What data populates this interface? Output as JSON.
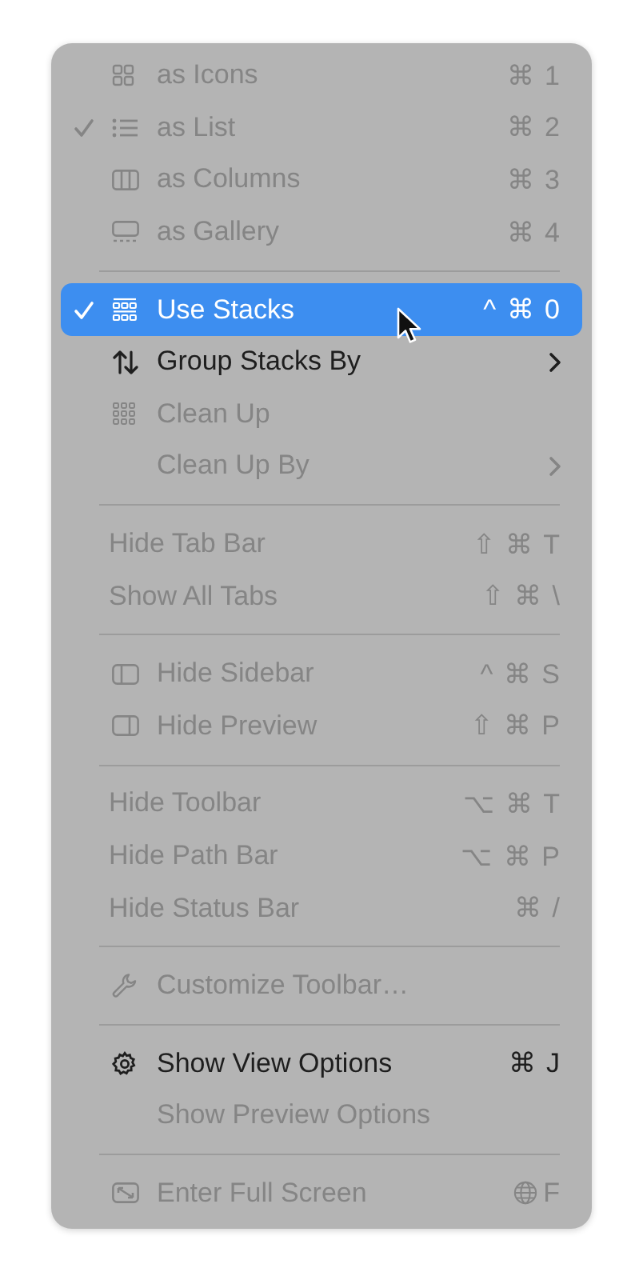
{
  "sections": [
    {
      "items": [
        {
          "label": "as Icons",
          "shortcut": "⌘ 1",
          "kind": "icons",
          "checked": false,
          "disabled": true,
          "selected": false,
          "submenu": false
        },
        {
          "label": "as List",
          "shortcut": "⌘ 2",
          "kind": "list",
          "checked": true,
          "disabled": true,
          "selected": false,
          "submenu": false
        },
        {
          "label": "as Columns",
          "shortcut": "⌘ 3",
          "kind": "columns",
          "checked": false,
          "disabled": true,
          "selected": false,
          "submenu": false
        },
        {
          "label": "as Gallery",
          "shortcut": "⌘ 4",
          "kind": "gallery",
          "checked": false,
          "disabled": true,
          "selected": false,
          "submenu": false
        }
      ]
    },
    {
      "items": [
        {
          "label": "Use Stacks",
          "shortcut": "^ ⌘ 0",
          "kind": "stacks",
          "checked": true,
          "disabled": false,
          "selected": true,
          "submenu": false
        },
        {
          "label": "Group Stacks By",
          "kind": "sort",
          "checked": false,
          "disabled": false,
          "selected": false,
          "submenu": true
        },
        {
          "label": "Clean Up",
          "kind": "cleanup",
          "checked": false,
          "disabled": true,
          "selected": false,
          "submenu": false
        },
        {
          "label": "Clean Up By",
          "kind": "plain",
          "checked": false,
          "disabled": true,
          "selected": false,
          "submenu": true
        }
      ]
    },
    {
      "items": [
        {
          "label": "Hide Tab Bar",
          "shortcut": "⇧ ⌘ T",
          "kind": "noicon",
          "checked": false,
          "disabled": true,
          "selected": false,
          "submenu": false
        },
        {
          "label": "Show All Tabs",
          "shortcut": "⇧ ⌘ \\",
          "kind": "noicon",
          "checked": false,
          "disabled": true,
          "selected": false,
          "submenu": false
        }
      ]
    },
    {
      "items": [
        {
          "label": "Hide Sidebar",
          "shortcut": "^ ⌘ S",
          "kind": "sidebar",
          "checked": false,
          "disabled": true,
          "selected": false,
          "submenu": false
        },
        {
          "label": "Hide Preview",
          "shortcut": "⇧ ⌘ P",
          "kind": "preview",
          "checked": false,
          "disabled": true,
          "selected": false,
          "submenu": false
        }
      ]
    },
    {
      "items": [
        {
          "label": "Hide Toolbar",
          "shortcut": "⌥ ⌘ T",
          "kind": "noicon",
          "checked": false,
          "disabled": true,
          "selected": false,
          "submenu": false
        },
        {
          "label": "Hide Path Bar",
          "shortcut": "⌥ ⌘ P",
          "kind": "noicon",
          "checked": false,
          "disabled": true,
          "selected": false,
          "submenu": false
        },
        {
          "label": "Hide Status Bar",
          "shortcut": "⌘ /",
          "kind": "noicon",
          "checked": false,
          "disabled": true,
          "selected": false,
          "submenu": false
        }
      ]
    },
    {
      "items": [
        {
          "label": "Customize Toolbar…",
          "kind": "wrench",
          "checked": false,
          "disabled": true,
          "selected": false,
          "submenu": false
        }
      ]
    },
    {
      "items": [
        {
          "label": "Show View Options",
          "shortcut": "⌘ J",
          "kind": "gear",
          "checked": false,
          "disabled": false,
          "selected": false,
          "submenu": false
        },
        {
          "label": "Show Preview Options",
          "kind": "plain",
          "checked": false,
          "disabled": true,
          "selected": false,
          "submenu": false
        }
      ]
    },
    {
      "items": [
        {
          "label": "Enter Full Screen",
          "shortcut": "F",
          "globe": true,
          "kind": "fullscreen",
          "checked": false,
          "disabled": true,
          "selected": false,
          "submenu": false
        }
      ]
    }
  ]
}
